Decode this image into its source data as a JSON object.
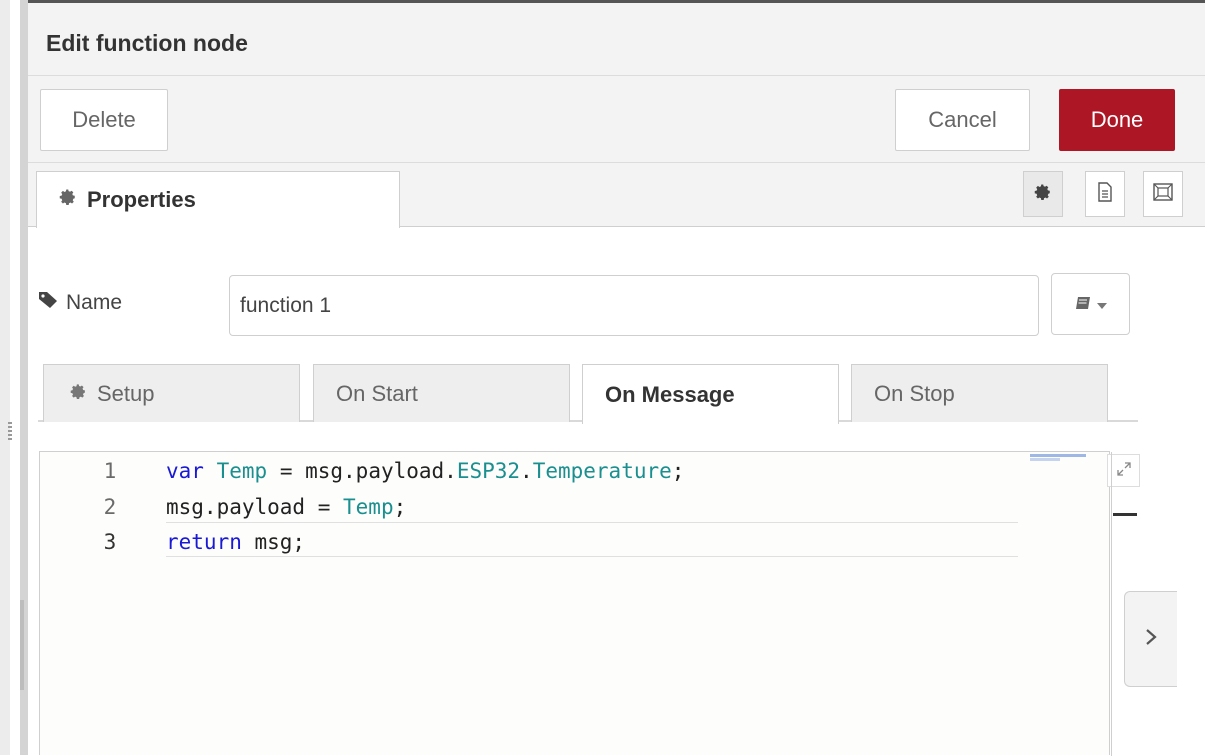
{
  "dialog": {
    "title": "Edit function node"
  },
  "toolbar": {
    "delete_label": "Delete",
    "cancel_label": "Cancel",
    "done_label": "Done"
  },
  "tabs": {
    "properties_label": "Properties"
  },
  "name_field": {
    "label": "Name",
    "value": "function 1"
  },
  "subtabs": [
    {
      "label": "Setup",
      "active": false
    },
    {
      "label": "On Start",
      "active": false
    },
    {
      "label": "On Message",
      "active": true
    },
    {
      "label": "On Stop",
      "active": false
    }
  ],
  "code": {
    "lines": [
      {
        "number": "1",
        "text": "var Temp = msg.payload.ESP32.Temperature;"
      },
      {
        "number": "2",
        "text": "msg.payload = Temp;"
      },
      {
        "number": "3",
        "text": "return msg;"
      }
    ]
  },
  "colors": {
    "done_button": "#ad1625",
    "keyword": "#1919d6",
    "variable": "#1a8f8f"
  },
  "icons": {
    "tab_gear": "gear-icon",
    "tab_doc": "document-icon",
    "tab_frame": "frame-icon",
    "name_tag": "tag-icon",
    "library": "book-icon",
    "expand": "expand-icon",
    "side_toggle": "chevron-right-icon"
  }
}
